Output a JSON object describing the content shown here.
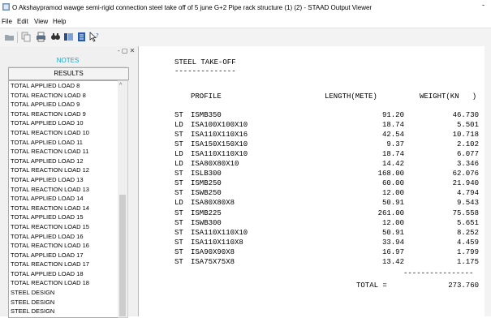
{
  "window": {
    "title": "O Akshaypramod wawge semi-rigid connection steel take off of 5 june G+2 Pipe rack structure (1) (2) - STAAD Output Viewer",
    "min_glyph": "-"
  },
  "menu": [
    "File",
    "Edit",
    "View",
    "Help"
  ],
  "toolbar": {
    "icons": [
      "open-icon",
      "copy-icon",
      "print-icon",
      "find-icon",
      "layout-icon",
      "report-icon",
      "help-pointer-icon"
    ]
  },
  "panel": {
    "buttons": "- ▢ ✕",
    "notes_tab": "NOTES",
    "results_header": "RESULTS"
  },
  "results_list": [
    "TOTAL APPLIED LOAD   8",
    "TOTAL REACTION LOAD   8",
    "TOTAL APPLIED LOAD   9",
    "TOTAL REACTION LOAD   9",
    "TOTAL APPLIED LOAD   10",
    "TOTAL REACTION LOAD   10",
    "TOTAL APPLIED LOAD   11",
    "TOTAL REACTION LOAD   11",
    "TOTAL APPLIED LOAD   12",
    "TOTAL REACTION LOAD   12",
    "TOTAL APPLIED LOAD   13",
    "TOTAL REACTION LOAD   13",
    "TOTAL APPLIED LOAD   14",
    "TOTAL REACTION LOAD   14",
    "TOTAL APPLIED LOAD   15",
    "TOTAL REACTION LOAD   15",
    "TOTAL APPLIED LOAD   16",
    "TOTAL REACTION LOAD   16",
    "TOTAL APPLIED LOAD   17",
    "TOTAL REACTION LOAD   17",
    "TOTAL APPLIED LOAD   18",
    "TOTAL REACTION LOAD   18",
    "STEEL DESIGN",
    "STEEL DESIGN",
    "STEEL DESIGN"
  ],
  "scroll_up_glyph": "^",
  "takeoff": {
    "heading": "STEEL TAKE-OFF",
    "heading_underline": "--------------",
    "col_profile": "PROFILE",
    "col_length": "LENGTH(METE)",
    "col_weight": "WEIGHT(KN   )",
    "rows": [
      {
        "type": "ST",
        "profile": "ISMB350",
        "length": "91.20",
        "weight": "46.730"
      },
      {
        "type": "LD",
        "profile": "ISA100X100X10",
        "length": "18.74",
        "weight": "5.501"
      },
      {
        "type": "ST",
        "profile": "ISA110X110X16",
        "length": "42.54",
        "weight": "10.718"
      },
      {
        "type": "ST",
        "profile": "ISA150X150X10",
        "length": "9.37",
        "weight": "2.102"
      },
      {
        "type": "LD",
        "profile": "ISA110X110X10",
        "length": "18.74",
        "weight": "6.077"
      },
      {
        "type": "LD",
        "profile": "ISA80X80X10",
        "length": "14.42",
        "weight": "3.346"
      },
      {
        "type": "ST",
        "profile": "ISLB300",
        "length": "168.00",
        "weight": "62.076"
      },
      {
        "type": "ST",
        "profile": "ISMB250",
        "length": "60.00",
        "weight": "21.940"
      },
      {
        "type": "ST",
        "profile": "ISWB250",
        "length": "12.00",
        "weight": "4.794"
      },
      {
        "type": "LD",
        "profile": "ISA80X80X8",
        "length": "50.91",
        "weight": "9.543"
      },
      {
        "type": "ST",
        "profile": "ISMB225",
        "length": "261.00",
        "weight": "75.558"
      },
      {
        "type": "ST",
        "profile": "ISWB300",
        "length": "12.00",
        "weight": "5.651"
      },
      {
        "type": "ST",
        "profile": "ISA110X110X10",
        "length": "50.91",
        "weight": "8.252"
      },
      {
        "type": "ST",
        "profile": "ISA110X110X8",
        "length": "33.94",
        "weight": "4.459"
      },
      {
        "type": "ST",
        "profile": "ISA90X90X8",
        "length": "16.97",
        "weight": "1.799"
      },
      {
        "type": "ST",
        "profile": "ISA75X75X8",
        "length": "13.42",
        "weight": "1.175"
      }
    ],
    "total_rule": "----------------",
    "total_label": "TOTAL =",
    "total_value": "273.760"
  }
}
